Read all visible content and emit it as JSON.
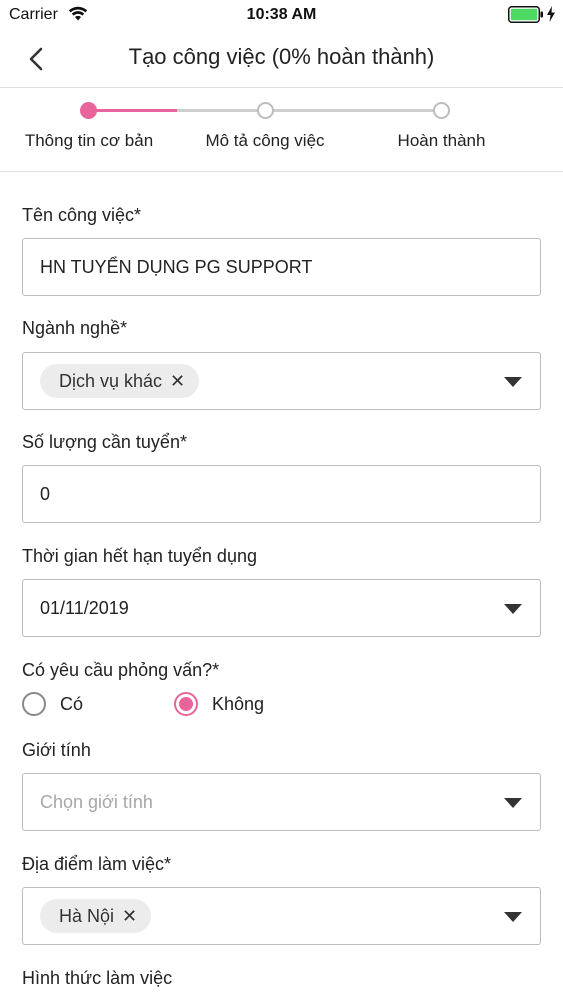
{
  "status_bar": {
    "carrier": "Carrier",
    "time": "10:38 AM"
  },
  "nav": {
    "title": "Tạo công việc (0% hoàn thành)"
  },
  "steps": [
    {
      "label": "Thông tin cơ bản"
    },
    {
      "label": "Mô tả công việc"
    },
    {
      "label": "Hoàn thành"
    }
  ],
  "form": {
    "job_name": {
      "label": "Tên công việc*",
      "value": "HN TUYỂN DỤNG PG SUPPORT"
    },
    "industry": {
      "label": "Ngành nghề*",
      "chip": "Dịch vụ khác"
    },
    "quantity": {
      "label": "Số lượng cần tuyển*",
      "value": "0"
    },
    "expiry": {
      "label": "Thời gian hết hạn tuyển dụng",
      "value": "01/11/2019"
    },
    "interview": {
      "label": "Có yêu cầu phỏng vấn?*",
      "option_yes": "Có",
      "option_no": "Không",
      "selected": "Không"
    },
    "gender": {
      "label": "Giới tính",
      "placeholder": "Chọn giới tính"
    },
    "location": {
      "label": "Địa điểm làm việc*",
      "chip": "Hà Nội"
    },
    "work_type": {
      "label": "Hình thức làm việc"
    }
  },
  "colors": {
    "accent": "#e8649b",
    "border": "#bcbcbc",
    "battery": "#4cd964"
  }
}
